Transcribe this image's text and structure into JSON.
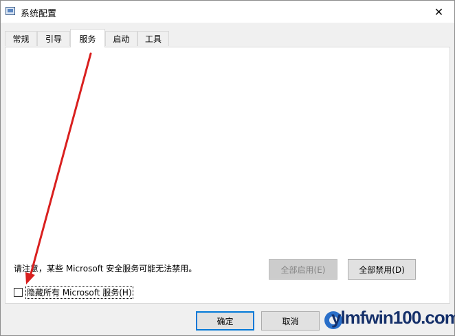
{
  "window": {
    "title": "系统配置",
    "close_glyph": "✕",
    "app_icon": "msconfig-icon"
  },
  "tabs": [
    {
      "label": "常规",
      "active": false
    },
    {
      "label": "引导",
      "active": false
    },
    {
      "label": "服务",
      "active": true
    },
    {
      "label": "启动",
      "active": false
    },
    {
      "label": "工具",
      "active": false
    }
  ],
  "services_panel": {
    "notice": "请注意，某些 Microsoft 安全服务可能无法禁用。",
    "enable_all_label": "全部启用(E)",
    "disable_all_label": "全部禁用(D)",
    "hide_ms_label": "隐藏所有 Microsoft 服务(H)",
    "hide_ms_checked": false
  },
  "footer": {
    "ok_label": "确定",
    "cancel_label": "取消"
  },
  "watermark": {
    "text": "ylmfwin100.com"
  },
  "colors": {
    "arrow": "#d9201f",
    "accent": "#0078d7"
  }
}
